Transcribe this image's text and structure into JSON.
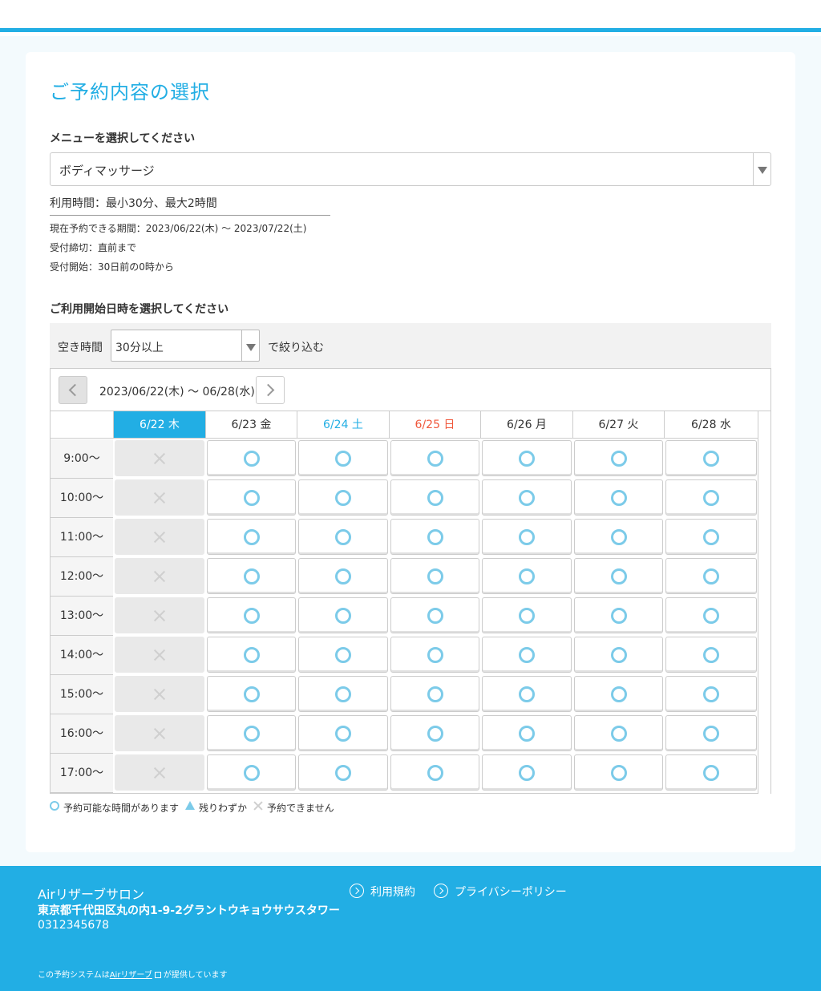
{
  "page": {
    "title": "ご予約内容の選択",
    "menu_label": "メニューを選択してください",
    "menu_selected": "ボディマッサージ",
    "usage_time": "利用時間：最小30分、最大2時間",
    "booking_period": "現在予約できる期間：2023/06/22(木) 〜 2023/07/22(土)",
    "deadline": "受付締切：直前まで",
    "start": "受付開始：30日前の0時から",
    "datetime_label": "ご利用開始日時を選択してください"
  },
  "filter": {
    "label": "空き時間",
    "selected": "30分以上",
    "suffix": "で絞り込む"
  },
  "calendar": {
    "range": "2023/06/22(木) 〜 06/28(水)",
    "days": [
      {
        "label": "6/22 木",
        "type": "today"
      },
      {
        "label": "6/23 金",
        "type": "weekday"
      },
      {
        "label": "6/24 土",
        "type": "sat"
      },
      {
        "label": "6/25 日",
        "type": "sun"
      },
      {
        "label": "6/26 月",
        "type": "weekday"
      },
      {
        "label": "6/27 火",
        "type": "weekday"
      },
      {
        "label": "6/28 水",
        "type": "weekday"
      }
    ],
    "times": [
      "9:00〜",
      "10:00〜",
      "11:00〜",
      "12:00〜",
      "13:00〜",
      "14:00〜",
      "15:00〜",
      "16:00〜",
      "17:00〜"
    ],
    "availability": [
      [
        "closed",
        "open",
        "open",
        "open",
        "open",
        "open",
        "open"
      ],
      [
        "closed",
        "open",
        "open",
        "open",
        "open",
        "open",
        "open"
      ],
      [
        "closed",
        "open",
        "open",
        "open",
        "open",
        "open",
        "open"
      ],
      [
        "closed",
        "open",
        "open",
        "open",
        "open",
        "open",
        "open"
      ],
      [
        "closed",
        "open",
        "open",
        "open",
        "open",
        "open",
        "open"
      ],
      [
        "closed",
        "open",
        "open",
        "open",
        "open",
        "open",
        "open"
      ],
      [
        "closed",
        "open",
        "open",
        "open",
        "open",
        "open",
        "open"
      ],
      [
        "closed",
        "open",
        "open",
        "open",
        "open",
        "open",
        "open"
      ],
      [
        "closed",
        "open",
        "open",
        "open",
        "open",
        "open",
        "open"
      ]
    ]
  },
  "legend": {
    "available": "予約可能な時間があります",
    "few": "残りわずか",
    "unavailable": "予約できません"
  },
  "footer": {
    "shop_name": "Airリザーブサロン",
    "address": "東京都千代田区丸の内1-9-2グラントウキョウサウスタワー",
    "phone": "0312345678",
    "terms": "利用規約",
    "privacy": "プライバシーポリシー",
    "powered_prefix": "この予約システムは",
    "powered_link": "Airリザーブ",
    "powered_suffix": "が提供しています"
  },
  "colors": {
    "accent": "#22aee4",
    "sunday": "#f0573b",
    "available_mark": "#7ccbe9"
  }
}
